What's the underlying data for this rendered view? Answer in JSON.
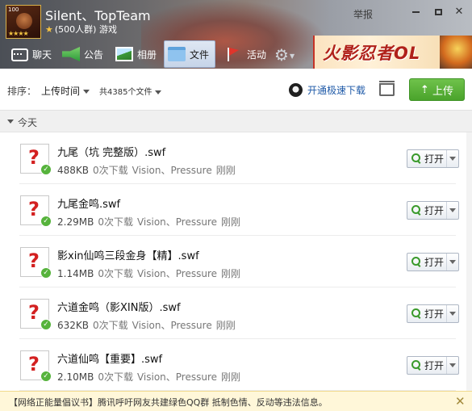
{
  "header": {
    "group_name": "Silent、TopTeam",
    "member_info": "(500人群) 游戏",
    "avatar_level": "100",
    "report_label": "举报",
    "ad_text": "火影忍者OL"
  },
  "tabs": [
    {
      "label": "聊天",
      "icon": "chat-icon"
    },
    {
      "label": "公告",
      "icon": "megaphone-icon"
    },
    {
      "label": "相册",
      "icon": "album-icon"
    },
    {
      "label": "文件",
      "icon": "folder-icon",
      "active": true
    },
    {
      "label": "活动",
      "icon": "flag-icon"
    }
  ],
  "toolbar": {
    "sort_label": "排序：",
    "sort_value": "上传时间",
    "file_count": "共4385个文件",
    "fast_download": "开通极速下载",
    "upload_label": "上传"
  },
  "group_header": {
    "label": "今天"
  },
  "files": [
    {
      "name": "九尾（坑 完整版）.swf",
      "size": "488KB",
      "downloads": "0次下载",
      "uploader": "Vision、Pressure",
      "time": "刚刚",
      "open_label": "打开"
    },
    {
      "name": "九尾金鸣.swf",
      "size": "2.29MB",
      "downloads": "0次下载",
      "uploader": "Vision、Pressure",
      "time": "刚刚",
      "open_label": "打开"
    },
    {
      "name": "影xin仙鸣三段金身【精】.swf",
      "size": "1.14MB",
      "downloads": "0次下载",
      "uploader": "Vision、Pressure",
      "time": "刚刚",
      "open_label": "打开"
    },
    {
      "name": "六道金鸣（影XIN版）.swf",
      "size": "632KB",
      "downloads": "0次下载",
      "uploader": "Vision、Pressure",
      "time": "刚刚",
      "open_label": "打开"
    },
    {
      "name": "六道仙鸣【重要】.swf",
      "size": "2.10MB",
      "downloads": "0次下载",
      "uploader": "Vision、Pressure",
      "time": "刚刚",
      "open_label": "打开"
    }
  ],
  "notice": {
    "text": "【网络正能量倡议书】腾讯呼吁网友共建绿色QQ群 抵制色情、反动等违法信息。"
  },
  "colors": {
    "accent_green": "#4aa32b",
    "link_blue": "#1f5aa8",
    "missing_icon_red": "#d32020"
  }
}
